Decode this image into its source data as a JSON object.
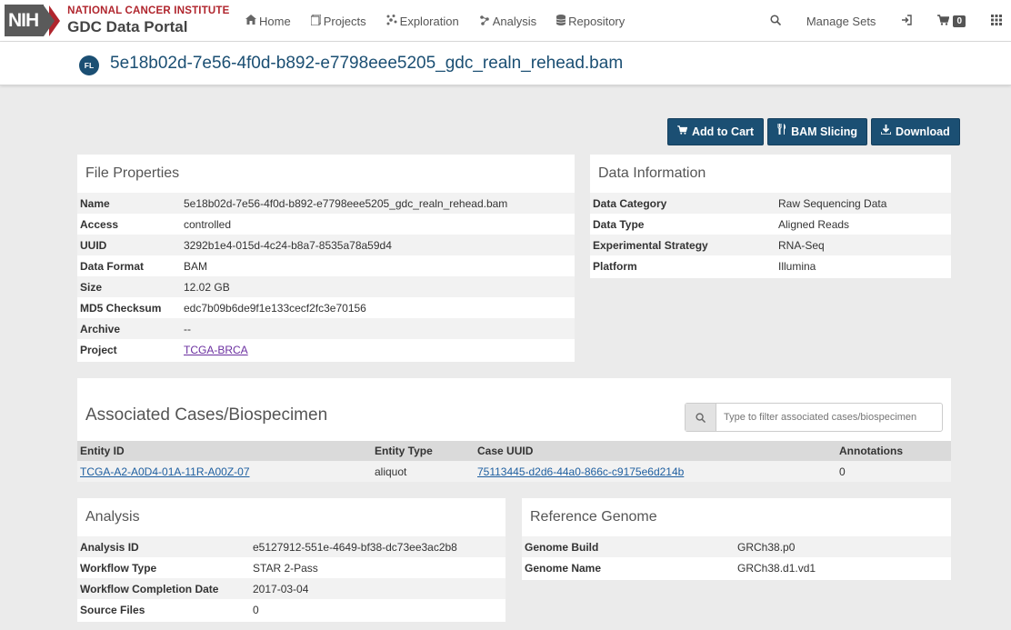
{
  "nav": {
    "logo_nih": "NIH",
    "logo_nci": "NATIONAL CANCER INSTITUTE",
    "logo_portal": "GDC Data Portal",
    "items": [
      {
        "label": "Home",
        "icon": "home-icon"
      },
      {
        "label": "Projects",
        "icon": "projects-icon"
      },
      {
        "label": "Exploration",
        "icon": "exploration-icon"
      },
      {
        "label": "Analysis",
        "icon": "analysis-icon"
      },
      {
        "label": "Repository",
        "icon": "database-icon"
      }
    ],
    "manage_sets": "Manage Sets",
    "cart_count": "0"
  },
  "title": {
    "badge": "FL",
    "filename": "5e18b02d-7e56-4f0d-b892-e7798eee5205_gdc_realn_rehead.bam"
  },
  "actions": {
    "add_to_cart": "Add to Cart",
    "bam_slicing": "BAM Slicing",
    "download": "Download"
  },
  "file_properties": {
    "title": "File Properties",
    "rows": [
      {
        "key": "Name",
        "value": "5e18b02d-7e56-4f0d-b892-e7798eee5205_gdc_realn_rehead.bam"
      },
      {
        "key": "Access",
        "value": "controlled"
      },
      {
        "key": "UUID",
        "value": "3292b1e4-015d-4c24-b8a7-8535a78a59d4"
      },
      {
        "key": "Data Format",
        "value": "BAM"
      },
      {
        "key": "Size",
        "value": "12.02 GB"
      },
      {
        "key": "MD5 Checksum",
        "value": "edc7b09b6de9f1e133cecf2fc3e70156"
      },
      {
        "key": "Archive",
        "value": "--"
      },
      {
        "key": "Project",
        "value": "TCGA-BRCA"
      }
    ]
  },
  "data_information": {
    "title": "Data Information",
    "rows": [
      {
        "key": "Data Category",
        "value": "Raw Sequencing Data"
      },
      {
        "key": "Data Type",
        "value": "Aligned Reads"
      },
      {
        "key": "Experimental Strategy",
        "value": "RNA-Seq"
      },
      {
        "key": "Platform",
        "value": "Illumina"
      }
    ]
  },
  "cases": {
    "title": "Associated Cases/Biospecimen",
    "filter_placeholder": "Type to filter associated cases/biospecimen",
    "columns": [
      "Entity ID",
      "Entity Type",
      "Case UUID",
      "Annotations"
    ],
    "rows": [
      {
        "entity_id": "TCGA-A2-A0D4-01A-11R-A00Z-07",
        "entity_type": "aliquot",
        "case_uuid": "75113445-d2d6-44a0-866c-c9175e6d214b",
        "annotations": "0"
      }
    ]
  },
  "analysis": {
    "title": "Analysis",
    "rows": [
      {
        "key": "Analysis ID",
        "value": "e5127912-551e-4649-bf38-dc73ee3ac2b8"
      },
      {
        "key": "Workflow Type",
        "value": "STAR 2-Pass"
      },
      {
        "key": "Workflow Completion Date",
        "value": "2017-03-04"
      },
      {
        "key": "Source Files",
        "value": "0"
      }
    ]
  },
  "reference_genome": {
    "title": "Reference Genome",
    "rows": [
      {
        "key": "Genome Build",
        "value": "GRCh38.p0"
      },
      {
        "key": "Genome Name",
        "value": "GRCh38.d1.vd1"
      }
    ]
  },
  "colors": {
    "primary": "#1b4f73",
    "nci_red": "#b0252d",
    "link": "#1e5fa0"
  }
}
